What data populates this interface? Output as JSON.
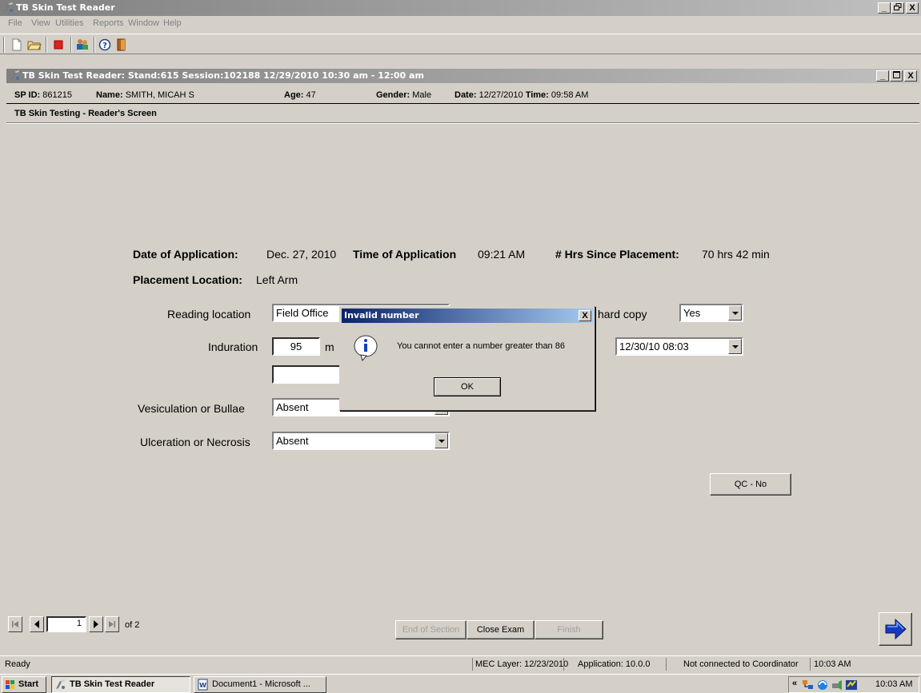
{
  "window": {
    "title": "TB Skin Test Reader",
    "minimize": "_",
    "restore": "□",
    "close": "X"
  },
  "menu": [
    "File",
    "View",
    "Utilities",
    "Reports",
    "Window",
    "Help"
  ],
  "toolbar_icons": [
    "new-icon",
    "open-icon",
    "stop-icon",
    "users-icon",
    "help-icon",
    "exit-icon"
  ],
  "child_window": {
    "title": "TB Skin Test Reader: Stand:615 Session:102188 12/29/2010 10:30 am - 12:00 am"
  },
  "patient": {
    "sp_id_label": "SP ID:",
    "sp_id": "861215",
    "name_label": "Name:",
    "name": "SMITH, MICAH S",
    "age_label": "Age:",
    "age": "47",
    "gender_label": "Gender:",
    "gender": "Male",
    "date_label": "Date:",
    "date": "12/27/2010",
    "time_label": "Time:",
    "time": "09:58 AM"
  },
  "screen_title": "TB Skin Testing - Reader's Screen",
  "application": {
    "date_label": "Date of Application:",
    "date": "Dec. 27, 2010",
    "time_label": "Time of Application",
    "time": "09:21 AM",
    "hrs_label": "# Hrs Since Placement:",
    "hrs": "70 hrs 42 min",
    "placement_label": "Placement Location:",
    "placement": "Left Arm"
  },
  "form": {
    "reading_location_label": "Reading location",
    "reading_location_value": "Field Office",
    "hard_copy_label": "hard copy",
    "hard_copy_value": "Yes",
    "induration_label": "Induration",
    "induration_value": "95",
    "induration_unit": "m",
    "datetime_value": "12/30/10 08:03",
    "extra_value": "",
    "vesiculation_label": "Vesiculation or Bullae",
    "vesiculation_value": "Absent",
    "ulceration_label": "Ulceration or Necrosis",
    "ulceration_value": "Absent",
    "qc_button": "QC - No"
  },
  "dialog": {
    "title": "Invalid number",
    "message": "You cannot enter a number greater than 86",
    "ok": "OK"
  },
  "nav": {
    "page": "1",
    "of_label": "of 2",
    "end_section": "End of Section",
    "close_exam": "Close Exam",
    "finish": "Finish"
  },
  "status": {
    "ready": "Ready",
    "mec_layer": "MEC Layer: 12/23/2010",
    "application": "Application: 10.0.0",
    "coordinator": "Not connected to Coordinator",
    "time": "10:03 AM"
  },
  "taskbar": {
    "start": "Start",
    "task1": "TB Skin Test Reader",
    "task2": "Document1 - Microsoft ...",
    "tray_chevron": "«",
    "clock": "10:03 AM"
  },
  "colors": {
    "face": "#d4d0c8",
    "active_title_start": "#0a246a",
    "active_title_end": "#a6caf0",
    "inactive_title": "#808080"
  }
}
